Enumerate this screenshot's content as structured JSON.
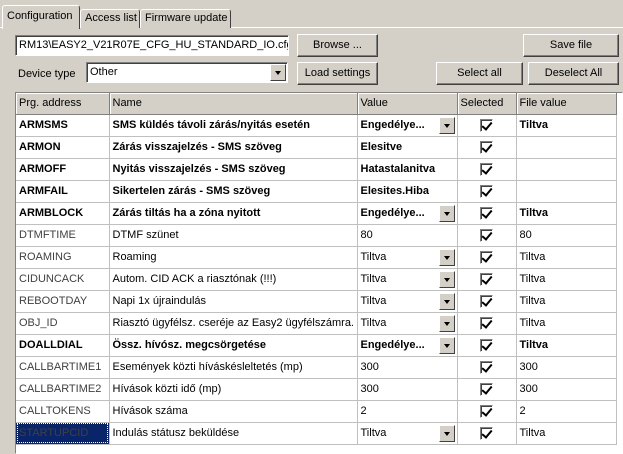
{
  "tabs": [
    {
      "label": "Configuration",
      "active": true
    },
    {
      "label": "Access list",
      "active": false
    },
    {
      "label": "Firmware update",
      "active": false
    }
  ],
  "file_path": "RM13\\EASY2_V21R07E_CFG_HU_STANDARD_IO.cfg",
  "buttons": {
    "browse": "Browse ...",
    "save_file": "Save file",
    "load_settings": "Load settings",
    "select_all": "Select all",
    "deselect_all": "Deselect All"
  },
  "device_type": {
    "label": "Device type",
    "value": "Other"
  },
  "table": {
    "headers": [
      "Prg. address",
      "Name",
      "Value",
      "Selected",
      "File value"
    ],
    "rows": [
      {
        "addr": "ARMSMS",
        "name": "SMS küldés távoli zárás/nyitás esetén",
        "value": "Engedélye...",
        "dropdown": true,
        "selected": true,
        "file_value": "Tiltva",
        "bold": true
      },
      {
        "addr": "ARMON",
        "name": "Zárás visszajelzés - SMS szöveg",
        "value": "Elesitve",
        "dropdown": false,
        "selected": true,
        "file_value": "",
        "bold": true
      },
      {
        "addr": "ARMOFF",
        "name": "Nyitás visszajelzés - SMS szöveg",
        "value": "Hatastalanitva",
        "dropdown": false,
        "selected": true,
        "file_value": "",
        "bold": true
      },
      {
        "addr": "ARMFAIL",
        "name": "Sikertelen zárás - SMS szöveg",
        "value": "Elesites.Hiba",
        "dropdown": false,
        "selected": true,
        "file_value": "",
        "bold": true
      },
      {
        "addr": "ARMBLOCK",
        "name": "Zárás tiltás ha a zóna nyitott",
        "value": "Engedélye...",
        "dropdown": true,
        "selected": true,
        "file_value": "Tiltva",
        "bold": true
      },
      {
        "addr": "DTMFTIME",
        "name": "DTMF szünet",
        "value": "80",
        "dropdown": false,
        "selected": true,
        "file_value": "80",
        "bold": false
      },
      {
        "addr": "ROAMING",
        "name": "Roaming",
        "value": "Tiltva",
        "dropdown": true,
        "selected": true,
        "file_value": "Tiltva",
        "bold": false
      },
      {
        "addr": "CIDUNCACK",
        "name": "Autom. CID ACK a riasztónak (!!!)",
        "value": "Tiltva",
        "dropdown": true,
        "selected": true,
        "file_value": "Tiltva",
        "bold": false
      },
      {
        "addr": "REBOOTDAY",
        "name": "Napi 1x újraindulás",
        "value": "Tiltva",
        "dropdown": true,
        "selected": true,
        "file_value": "Tiltva",
        "bold": false
      },
      {
        "addr": "OBJ_ID",
        "name": "Riasztó ügyfélsz. cseréje az Easy2 ügyfélszámra.",
        "value": "Tiltva",
        "dropdown": true,
        "selected": true,
        "file_value": "Tiltva",
        "bold": false
      },
      {
        "addr": "DOALLDIAL",
        "name": "Össz. hívósz. megcsörgetése",
        "value": "Engedélye...",
        "dropdown": true,
        "selected": true,
        "file_value": "Tiltva",
        "bold": true
      },
      {
        "addr": "CALLBARTIME1",
        "name": "Események közti híváskésleltetés (mp)",
        "value": "300",
        "dropdown": false,
        "selected": true,
        "file_value": "300",
        "bold": false
      },
      {
        "addr": "CALLBARTIME2",
        "name": "Hívások közti idő (mp)",
        "value": "300",
        "dropdown": false,
        "selected": true,
        "file_value": "300",
        "bold": false
      },
      {
        "addr": "CALLTOKENS",
        "name": "Hívások száma",
        "value": "2",
        "dropdown": false,
        "selected": true,
        "file_value": "2",
        "bold": false
      },
      {
        "addr": "STARTUPCID",
        "name": "Indulás státusz beküldése",
        "value": "Tiltva",
        "dropdown": true,
        "selected": true,
        "file_value": "Tiltva",
        "bold": false,
        "focused": true
      }
    ]
  }
}
